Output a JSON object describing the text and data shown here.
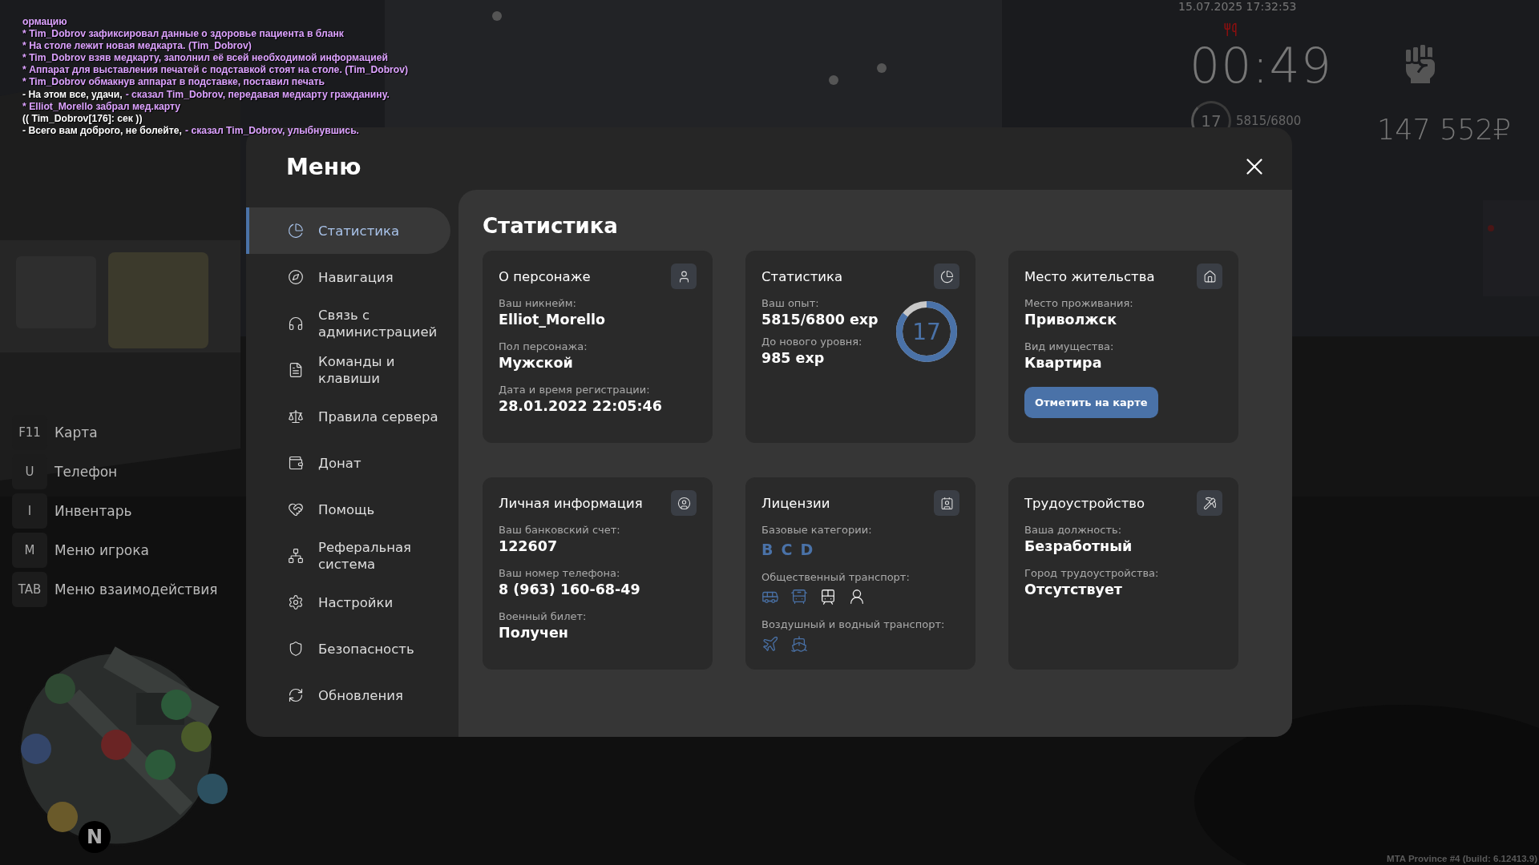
{
  "chat": [
    {
      "kind": "action",
      "text": "ормацию"
    },
    {
      "kind": "action",
      "text": "* Tim_Dobrov зафиксировал данные о здоровье пациента в бланк"
    },
    {
      "kind": "action",
      "text": "* На столе лежит новая медкарта. (Tim_Dobrov)"
    },
    {
      "kind": "action",
      "text": "* Tim_Dobrov взяв медкарту, заполнил её всей необходимой информацией"
    },
    {
      "kind": "action",
      "text": "* Аппарат для выставления печатей с подставкой стоят на столе. (Tim_Dobrov)"
    },
    {
      "kind": "action",
      "text": "* Tim_Dobrov обмакнув аппарат в подставке, поставил печать"
    },
    {
      "kind": "speech",
      "text": "- На этом все, удачи,",
      "remark": "- сказал Tim_Dobrov, передавая медкарту гражданину."
    },
    {
      "kind": "action",
      "text": "* Elliot_Morello забрал мед.карту"
    },
    {
      "kind": "ooc",
      "text": "(( Tim_Dobrov[176]: сек ))"
    },
    {
      "kind": "speech",
      "text": "- Всего вам доброго, не болейте,",
      "remark": "- сказал Tim_Dobrov, улыбнувшись."
    }
  ],
  "hud": {
    "date": "15.07.2025 17:32:53",
    "timer": "00:49",
    "level": "17",
    "exp": "5815/6800",
    "money": "147 552₽"
  },
  "key_hints": [
    {
      "key": "F11",
      "label": "Карта"
    },
    {
      "key": "U",
      "label": "Телефон"
    },
    {
      "key": "I",
      "label": "Инвентарь"
    },
    {
      "key": "M",
      "label": "Меню игрока"
    },
    {
      "key": "TAB",
      "label": "Меню взаимодействия"
    }
  ],
  "minimap": {
    "compass": "N"
  },
  "menu": {
    "title": "Меню",
    "sidebar": {
      "items": [
        {
          "label": "Статистика",
          "selected": true
        },
        {
          "label": "Навигация",
          "selected": false
        },
        {
          "label": "Связь с администрацией",
          "selected": false
        },
        {
          "label": "Команды и клавиши",
          "selected": false
        },
        {
          "label": "Правила сервера",
          "selected": false
        },
        {
          "label": "Донат",
          "selected": false
        },
        {
          "label": "Помощь",
          "selected": false
        },
        {
          "label": "Реферальная система",
          "selected": false
        },
        {
          "label": "Настройки",
          "selected": false
        },
        {
          "label": "Безопасность",
          "selected": false
        },
        {
          "label": "Обновления",
          "selected": false
        }
      ]
    },
    "section_title": "Статистика",
    "cards": [
      {
        "kind": "character",
        "title": "О персонаже",
        "fields": [
          {
            "label": "Ваш никнейм:",
            "value": "Elliot_Morello"
          },
          {
            "label": "Пол персонажа:",
            "value": "Мужской"
          },
          {
            "label": "Дата и время регистрации:",
            "value": "28.01.2022 22:05:46"
          }
        ]
      },
      {
        "kind": "stats",
        "title": "Статистика",
        "fields": [
          {
            "label": "Ваш опыт:",
            "value": "5815/6800 exp"
          },
          {
            "label": "До нового уровня:",
            "value": "985 exp"
          }
        ],
        "ring": {
          "text": "17",
          "level": 0.855
        }
      },
      {
        "kind": "residence",
        "title": "Место жительства",
        "fields": [
          {
            "label": "Место проживания:",
            "value": "Приволжск"
          },
          {
            "label": "Вид имущества:",
            "value": "Квартира"
          }
        ],
        "button": "Отметить на карте"
      },
      {
        "kind": "personal",
        "title": "Личная информация",
        "fields": [
          {
            "label": "Ваш банковский счет:",
            "value": "122607"
          },
          {
            "label": "Ваш номер телефона:",
            "value": "8 (963) 160-68-49"
          },
          {
            "label": "Военный билет:",
            "value": "Получен"
          }
        ]
      },
      {
        "kind": "licenses",
        "title": "Лицензии",
        "categories": {
          "label": "Базовые категории:",
          "items": [
            "B",
            "C",
            "D"
          ]
        },
        "public_transport": {
          "label": "Общественный транспорт:",
          "items": [
            {
              "owned": true
            },
            {
              "owned": true
            },
            {
              "owned": false
            },
            {
              "owned": false
            }
          ]
        },
        "air_water": {
          "label": "Воздушный и водный транспорт:",
          "items": [
            {
              "owned": true
            },
            {
              "owned": true
            }
          ]
        }
      },
      {
        "kind": "job",
        "title": "Трудоустройство",
        "fields": [
          {
            "label": "Ваша должность:",
            "value": "Безработный"
          },
          {
            "label": "Город трудоустройства:",
            "value": "Отсутствует"
          }
        ]
      }
    ]
  },
  "build_info": "MTA Province #4 (build: 6.12413.9)"
}
